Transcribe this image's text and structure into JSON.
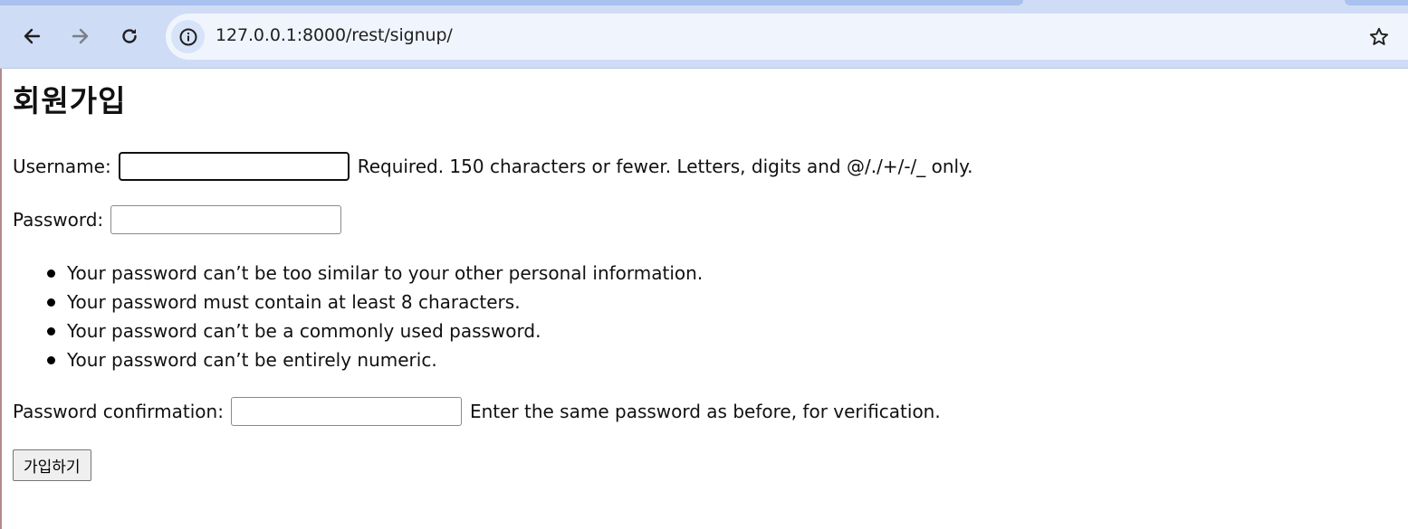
{
  "browser": {
    "url": "127.0.0.1:8000/rest/signup/",
    "icons": {
      "back": "arrow-left-icon",
      "forward": "arrow-right-icon",
      "reload": "reload-icon",
      "site_info": "info-icon",
      "bookmark": "star-icon"
    }
  },
  "page": {
    "title": "회원가입",
    "username": {
      "label": "Username:",
      "value": "",
      "help": "Required. 150 characters or fewer. Letters, digits and @/./+/-/_ only."
    },
    "password": {
      "label": "Password:",
      "value": ""
    },
    "password_rules": [
      "Your password can’t be too similar to your other personal information.",
      "Your password must contain at least 8 characters.",
      "Your password can’t be a commonly used password.",
      "Your password can’t be entirely numeric."
    ],
    "password_confirmation": {
      "label": "Password confirmation:",
      "value": "",
      "help": "Enter the same password as before, for verification."
    },
    "submit_label": "가입하기"
  }
}
